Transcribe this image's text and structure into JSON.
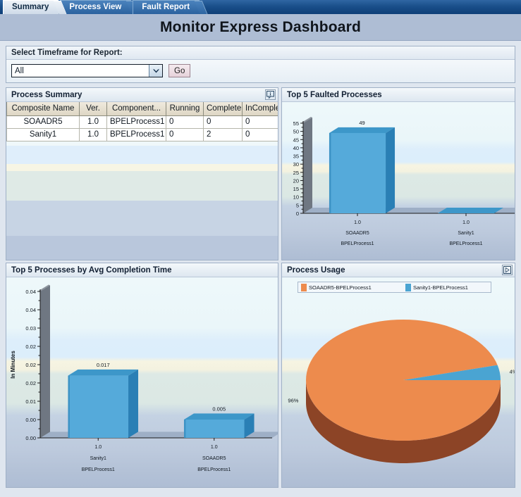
{
  "tabs": [
    {
      "label": "Summary",
      "active": true
    },
    {
      "label": "Process View",
      "active": false
    },
    {
      "label": "Fault Report",
      "active": false
    }
  ],
  "header": {
    "title": "Monitor Express Dashboard"
  },
  "timeframe": {
    "legend": "Select Timeframe for Report:",
    "selected": "All",
    "go_label": "Go"
  },
  "process_summary": {
    "title": "Process Summary",
    "icon": "detach-info-icon",
    "columns": [
      "Composite Name",
      "Ver.",
      "Component...",
      "Running",
      "Complete",
      "InComplete"
    ],
    "rows": [
      [
        "SOAADR5",
        "1.0",
        "BPELProcess1",
        "0",
        "0",
        "0"
      ],
      [
        "Sanity1",
        "1.0",
        "BPELProcess1",
        "0",
        "2",
        "0"
      ]
    ]
  },
  "faulted": {
    "title": "Top 5 Faulted Processes"
  },
  "completion": {
    "title": "Top 5 Processes by Avg Completion Time"
  },
  "usage": {
    "title": "Process Usage",
    "icon": "play-next-icon"
  },
  "colors": {
    "bar_face": "#55aada",
    "bar_top": "#3d97c9",
    "bar_side": "#2a7fb5",
    "pie_orange": "#ed8b4d",
    "pie_blue": "#4aa4d2",
    "pie_orange_dark": "#8c4426",
    "pie_blue_dark": "#1f5f85",
    "tabbar": "#1a4f8a",
    "titlebar": "#aebdd4",
    "axis": "#1a1a1a"
  },
  "chart_data": [
    {
      "type": "bar",
      "title": "Top 5 Faulted Processes",
      "categories": [
        "1.0\nSOAADR5\nBPELProcess1",
        "1.0\nSanity1\nBPELProcess1"
      ],
      "category_lines": [
        [
          "1.0",
          "SOAADR5",
          "BPELProcess1"
        ],
        [
          "1.0",
          "Sanity1",
          "BPELProcess1"
        ]
      ],
      "values": [
        49,
        0
      ],
      "data_labels": [
        "49",
        ""
      ],
      "yticks": [
        0,
        5,
        10,
        15,
        20,
        25,
        30,
        35,
        40,
        45,
        50,
        55
      ],
      "ytick_labels": [
        "0",
        "5",
        "10",
        "15",
        "20",
        "25",
        "30",
        "35",
        "40",
        "45",
        "50",
        "55"
      ],
      "ylim": [
        0,
        55
      ],
      "xlabel": "",
      "ylabel": "",
      "grid": false,
      "legend": "none"
    },
    {
      "type": "bar",
      "title": "Top 5 Processes by Avg Completion Time",
      "categories": [
        "1.0\nSanity1\nBPELProcess1",
        "1.0\nSOAADR5\nBPELProcess1"
      ],
      "category_lines": [
        [
          "1.0",
          "Sanity1",
          "BPELProcess1"
        ],
        [
          "1.0",
          "SOAADR5",
          "BPELProcess1"
        ]
      ],
      "values": [
        0.017,
        0.005
      ],
      "data_labels": [
        "0.017",
        "0.005"
      ],
      "yticks": [
        0.0,
        0.005,
        0.01,
        0.015,
        0.02,
        0.025,
        0.03,
        0.035,
        0.04
      ],
      "ytick_labels": [
        "0.00",
        "0.00",
        "0.01",
        "0.02",
        "0.02",
        "0.02",
        "0.03",
        "0.04",
        "0.04"
      ],
      "ylim": [
        0,
        0.04
      ],
      "xlabel": "",
      "ylabel": "In Minutes",
      "grid": false,
      "legend": "none"
    },
    {
      "type": "pie",
      "title": "Process Usage",
      "labels": [
        "SOAADR5-BPELProcess1",
        "Sanity1-BPELProcess1"
      ],
      "values": [
        96,
        4
      ],
      "data_labels": [
        "96%",
        "4%"
      ],
      "colors": [
        "#ed8b4d",
        "#4aa4d2"
      ],
      "legend": "top"
    }
  ]
}
